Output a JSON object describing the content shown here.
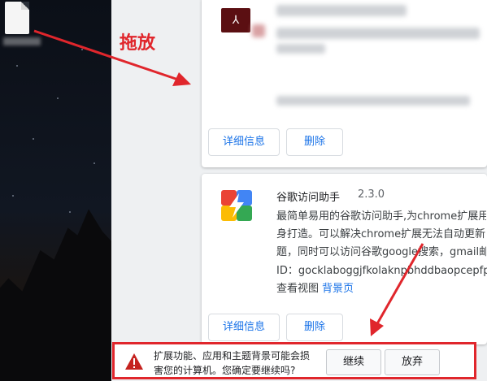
{
  "annotation": {
    "drag_label": "拖放"
  },
  "card1": {
    "details_button": "详细信息",
    "remove_button": "删除"
  },
  "card2": {
    "name": "谷歌访问助手",
    "version": "2.3.0",
    "description_lines": [
      "最简单易用的谷歌访问助手,为chrome扩展用",
      "身打造。可以解决chrome扩展无法自动更新",
      "题，同时可以访问谷歌google搜索，gmail邮"
    ],
    "id_label": "ID：",
    "id_value": "gocklaboggjfkolaknpbhddbaopcepfp",
    "views_label": "查看视图",
    "views_link": "背景页",
    "details_button": "详细信息",
    "remove_button": "删除"
  },
  "warning": {
    "line1": "扩展功能、应用和主题背景可能会损",
    "line2": "害您的计算机。您确定要继续吗?",
    "continue_button": "继续",
    "discard_button": "放弃"
  },
  "colors": {
    "annotation_red": "#e0262c",
    "link_blue": "#1a73e8"
  }
}
